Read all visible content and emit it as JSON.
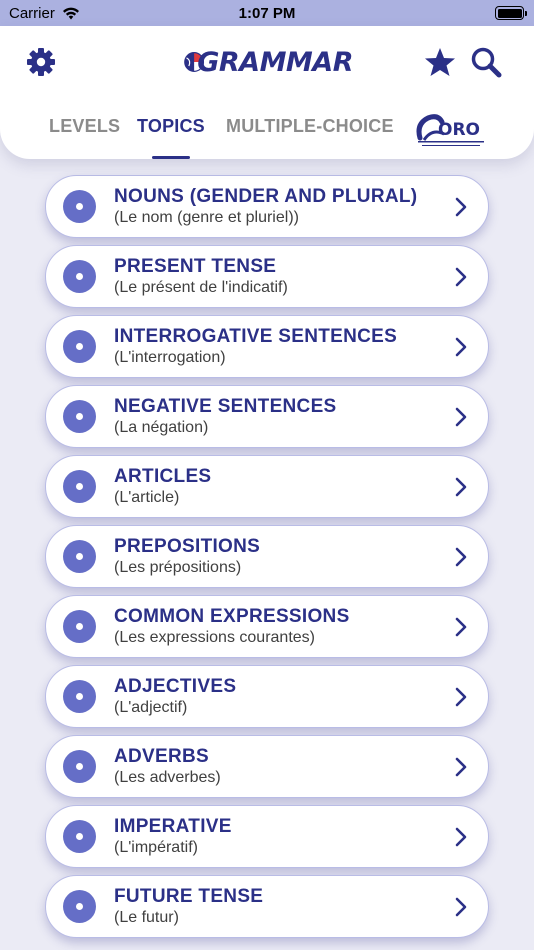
{
  "status": {
    "carrier": "Carrier",
    "time": "1:07 PM"
  },
  "header": {
    "logo_text": "GRAMMAR",
    "oro_logo_text": "ORO",
    "icons": [
      "gear-icon",
      "star-icon",
      "search-icon"
    ],
    "tabs": [
      {
        "label": "LEVELS",
        "active": false
      },
      {
        "label": "TOPICS",
        "active": true
      },
      {
        "label": "MULTIPLE-CHOICE",
        "active": false
      }
    ]
  },
  "colors": {
    "accent": "#2b3087",
    "bullet": "#656ec7",
    "status_bar": "#abb1e0",
    "background": "#ebebf5"
  },
  "topics": [
    {
      "title": "NOUNS (GENDER AND PLURAL)",
      "subtitle": "(Le nom (genre et pluriel))"
    },
    {
      "title": "PRESENT TENSE",
      "subtitle": "(Le présent de l'indicatif)"
    },
    {
      "title": "INTERROGATIVE SENTENCES",
      "subtitle": "(L'interrogation)"
    },
    {
      "title": "NEGATIVE SENTENCES",
      "subtitle": "(La négation)"
    },
    {
      "title": "ARTICLES",
      "subtitle": "(L'article)"
    },
    {
      "title": "PREPOSITIONS",
      "subtitle": "(Les prépositions)"
    },
    {
      "title": "COMMON EXPRESSIONS",
      "subtitle": "(Les expressions courantes)"
    },
    {
      "title": "ADJECTIVES",
      "subtitle": "(L'adjectif)"
    },
    {
      "title": "ADVERBS",
      "subtitle": "(Les adverbes)"
    },
    {
      "title": "IMPERATIVE",
      "subtitle": "(L'impératif)"
    },
    {
      "title": "FUTURE TENSE",
      "subtitle": "(Le futur)"
    }
  ]
}
